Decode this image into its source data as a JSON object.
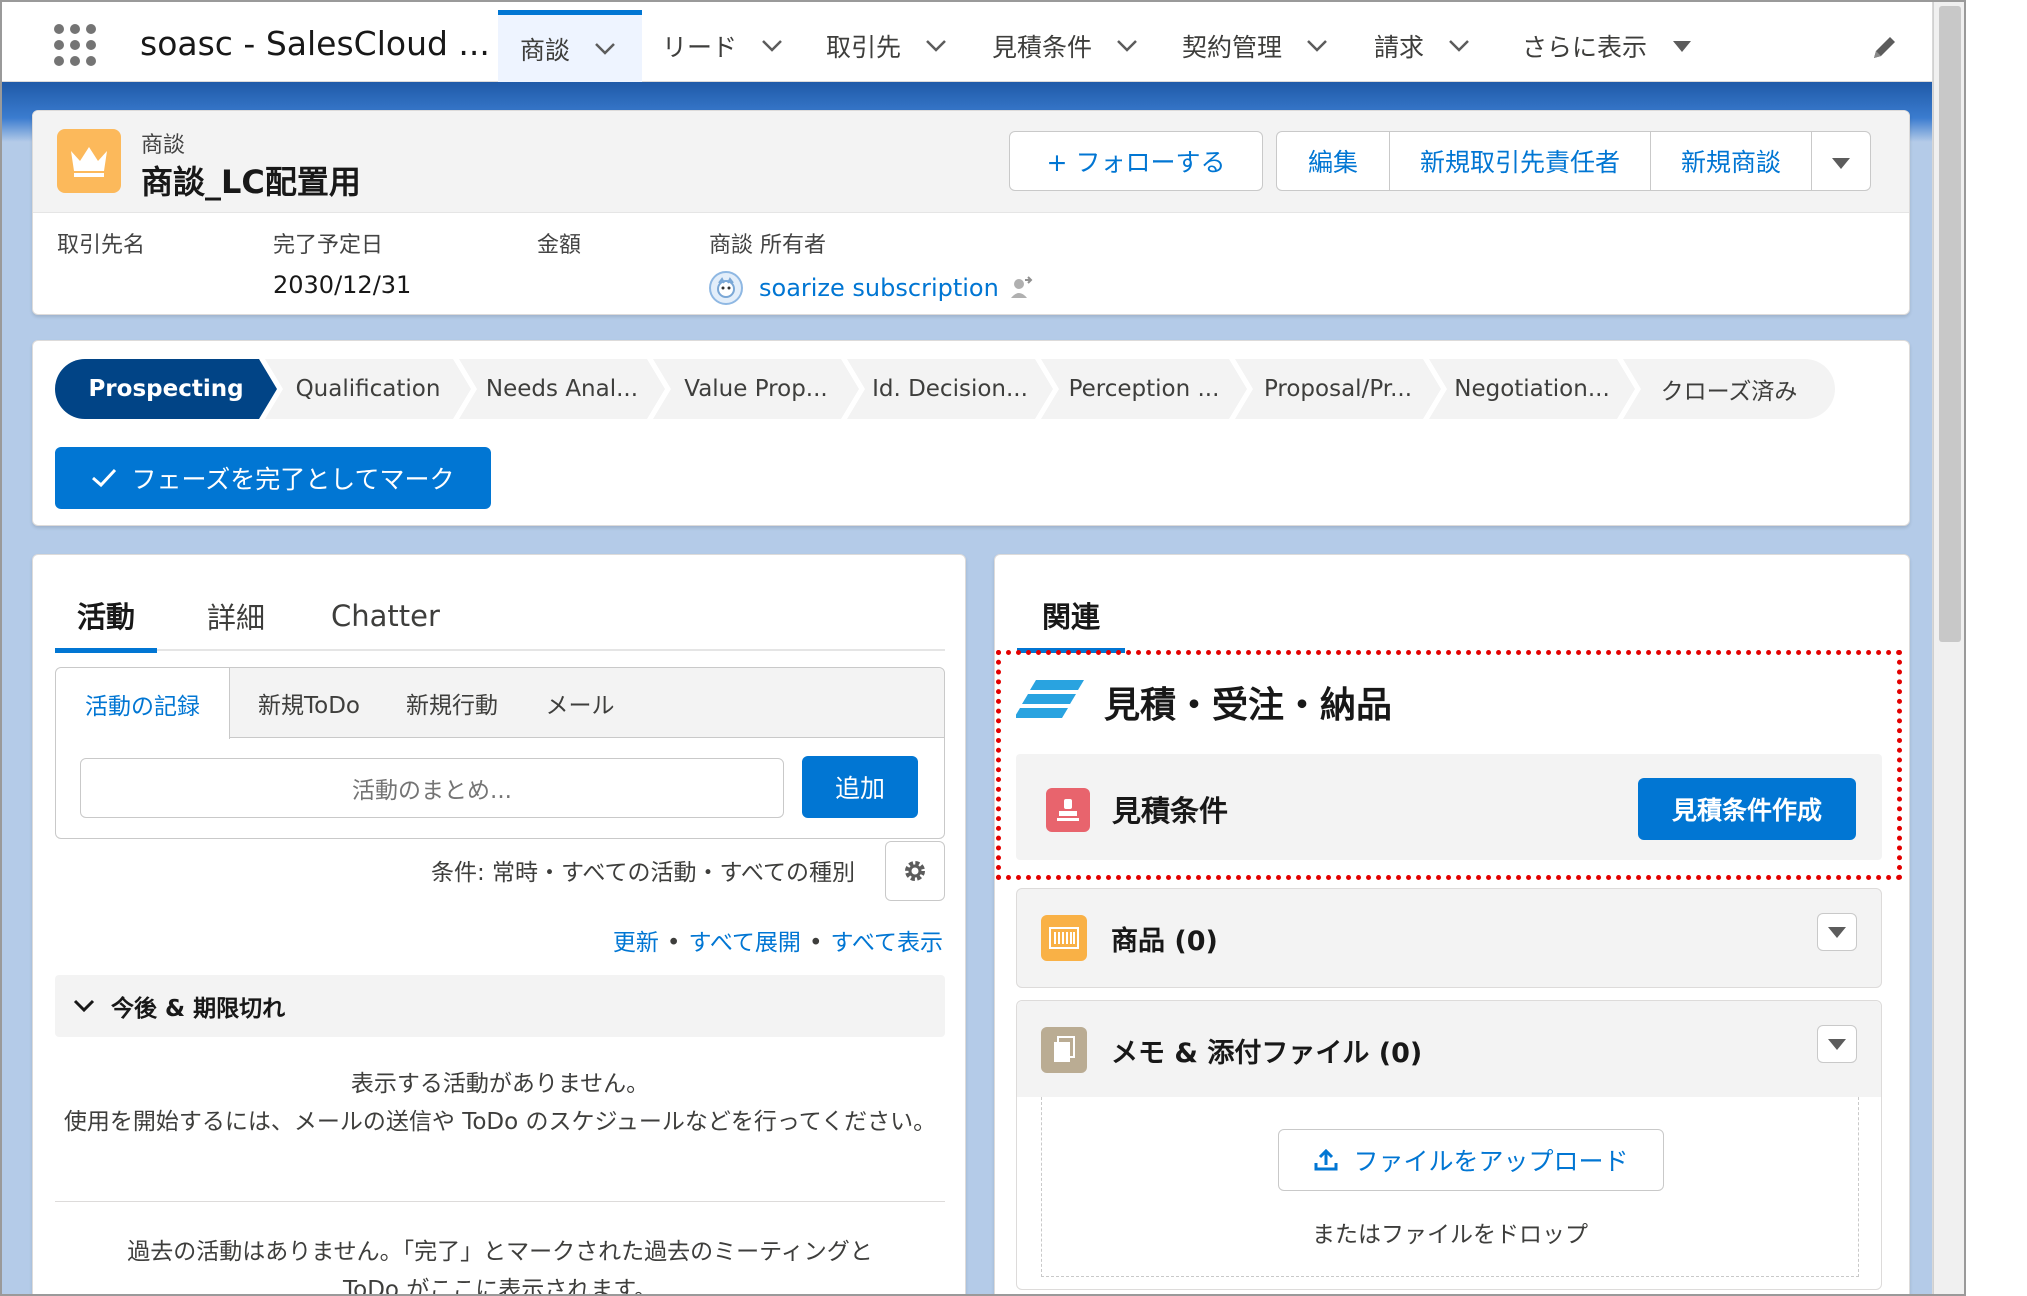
{
  "nav": {
    "app_name": "soasc - SalesCloud ...",
    "items": [
      {
        "label": "商談",
        "active": true
      },
      {
        "label": "リード"
      },
      {
        "label": "取引先"
      },
      {
        "label": "見積条件"
      },
      {
        "label": "契約管理"
      },
      {
        "label": "請求"
      },
      {
        "label": "さらに表示"
      }
    ]
  },
  "record": {
    "type": "商談",
    "name": "商談_LC配置用",
    "follow_label": "+ フォローする",
    "actions": [
      "編集",
      "新規取引先責任者",
      "新規商談"
    ],
    "fields": [
      {
        "label": "取引先名",
        "value": ""
      },
      {
        "label": "完了予定日",
        "value": "2030/12/31"
      },
      {
        "label": "金額",
        "value": ""
      },
      {
        "label": "商談 所有者",
        "value": "soarize subscription"
      }
    ]
  },
  "path": {
    "stages": [
      "Prospecting",
      "Qualification",
      "Needs Anal...",
      "Value Prop...",
      "Id. Decision...",
      "Perception ...",
      "Proposal/Pr...",
      "Negotiation...",
      "クローズ済み"
    ],
    "current": 0,
    "mark_complete_label": "フェーズを完了としてマーク"
  },
  "activity": {
    "tabs": [
      "活動",
      "詳細",
      "Chatter"
    ],
    "subtabs": [
      "活動の記録",
      "新規ToDo",
      "新規行動",
      "メール"
    ],
    "summary_placeholder": "活動のまとめ...",
    "add_label": "追加",
    "filter_text": "条件: 常時・すべての活動・すべての種別",
    "links": [
      "更新",
      "すべて展開",
      "すべて表示"
    ],
    "upcoming_label": "今後 & 期限切れ",
    "empty_line1": "表示する活動がありません。",
    "empty_line2": "使用を開始するには、メールの送信や ToDo のスケジュールなどを行ってください。",
    "past_line1": "過去の活動はありません。「完了」とマークされた過去のミーティングと",
    "past_line2": "ToDo がここに表示されます。"
  },
  "related": {
    "tab_label": "関連",
    "qoh_title": "見積・受注・納品",
    "quote_title": "見積条件",
    "quote_button": "見積条件作成",
    "products_title": "商品 (0)",
    "notes_title": "メモ & 添付ファイル (0)",
    "upload_label": "ファイルをアップロード",
    "drop_text": "またはファイルをドロップ"
  },
  "colors": {
    "brand_blue": "#0176d3",
    "path_current": "#014486",
    "opportunity_icon": "#fcb95b",
    "quote_icon": "#e8646d",
    "highlight_border": "#e30000"
  }
}
